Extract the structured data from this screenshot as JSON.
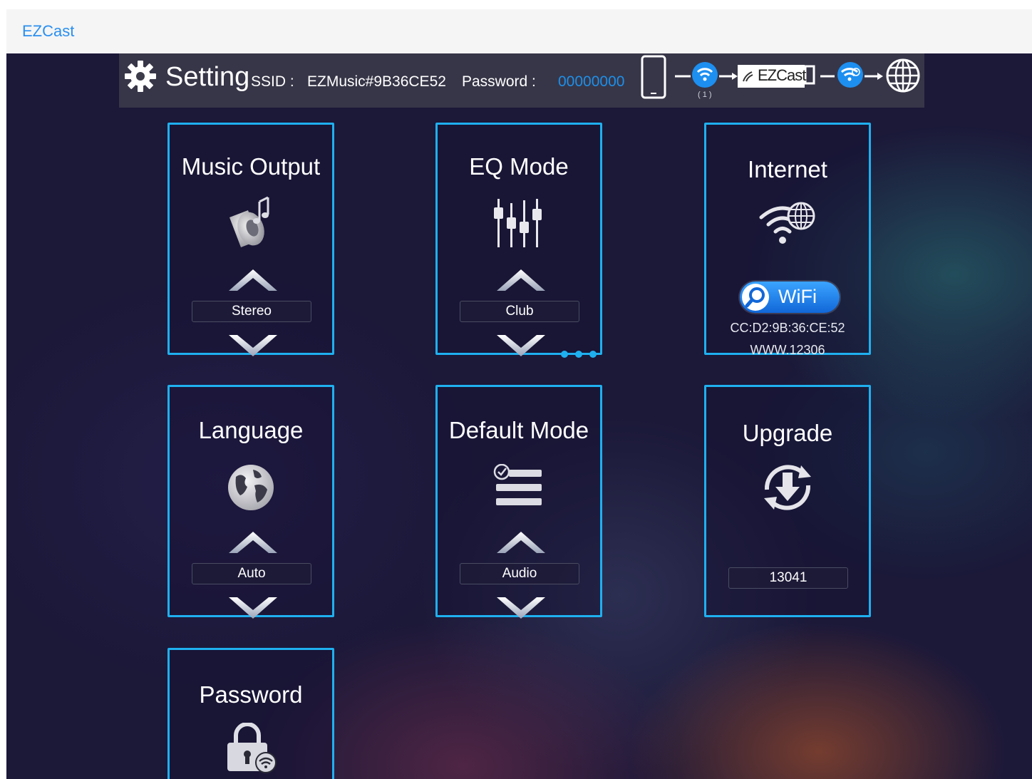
{
  "app": {
    "brand": "EZCast"
  },
  "header": {
    "title": "Setting",
    "ssid_label": "SSID :",
    "ssid_value": "EZMusic#9B36CE52",
    "password_label": "Password :",
    "password_value": "00000000",
    "connected_count": "( 1 )",
    "device_logo_text": "EZCast",
    "icons": [
      "gear-icon",
      "phone-icon",
      "wifi-device-icon",
      "ezcast-dongle-icon",
      "wifi-router-icon",
      "globe-icon"
    ]
  },
  "tiles": {
    "music_output": {
      "title": "Music Output",
      "value": "Stereo",
      "icon": "music-speaker-icon"
    },
    "eq_mode": {
      "title": "EQ Mode",
      "value": "Club",
      "icon": "equalizer-icon"
    },
    "internet": {
      "title": "Internet",
      "button_label": "WiFi",
      "mac": "CC:D2:9B:36:CE:52",
      "network": "WWW.12306",
      "icon": "wifi-globe-icon"
    },
    "language": {
      "title": "Language",
      "value": "Auto",
      "icon": "world-icon"
    },
    "default_mode": {
      "title": "Default Mode",
      "value": "Audio",
      "icon": "checklist-icon"
    },
    "upgrade": {
      "title": "Upgrade",
      "value": "13041",
      "icon": "upgrade-icon"
    },
    "password": {
      "title": "Password",
      "icon": "lock-wifi-icon"
    }
  },
  "colors": {
    "accent": "#1fb0ef",
    "brand": "#2a8ff0",
    "password_value": "#1e8fe8",
    "background": "#1b1838"
  }
}
